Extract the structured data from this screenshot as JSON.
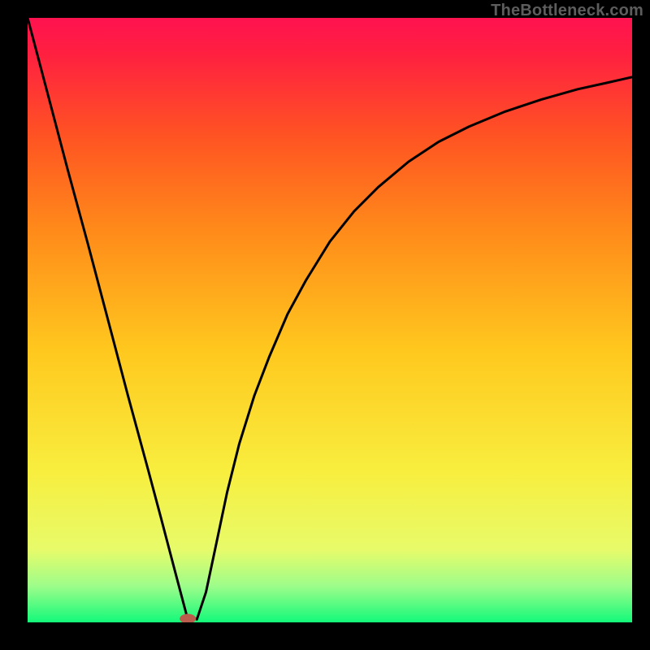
{
  "watermark": {
    "text": "TheBottleneck.com"
  },
  "chart_data": {
    "type": "line",
    "title": "",
    "xlabel": "",
    "ylabel": "",
    "xlim": [
      0,
      1
    ],
    "ylim": [
      0,
      1
    ],
    "grid": false,
    "background_gradient": {
      "stops": [
        {
          "offset": 0.0,
          "color": "#ff1250"
        },
        {
          "offset": 0.06,
          "color": "#ff2040"
        },
        {
          "offset": 0.2,
          "color": "#ff5522"
        },
        {
          "offset": 0.35,
          "color": "#ff8a1a"
        },
        {
          "offset": 0.55,
          "color": "#ffc81e"
        },
        {
          "offset": 0.75,
          "color": "#f8ee3e"
        },
        {
          "offset": 0.88,
          "color": "#e7fb6a"
        },
        {
          "offset": 0.94,
          "color": "#9dfd8a"
        },
        {
          "offset": 1.0,
          "color": "#13f97a"
        }
      ]
    },
    "series": [
      {
        "name": "bottleneck-curve",
        "color": "#000000",
        "width": 3,
        "x": [
          0.0,
          0.033,
          0.066,
          0.1,
          0.133,
          0.166,
          0.2,
          0.22,
          0.245,
          0.263,
          0.28,
          0.295,
          0.31,
          0.33,
          0.35,
          0.375,
          0.4,
          0.43,
          0.46,
          0.5,
          0.54,
          0.58,
          0.63,
          0.68,
          0.73,
          0.79,
          0.85,
          0.91,
          0.96,
          1.0
        ],
        "y": [
          1.0,
          0.875,
          0.75,
          0.625,
          0.5,
          0.375,
          0.25,
          0.175,
          0.08,
          0.012,
          0.005,
          0.05,
          0.12,
          0.215,
          0.295,
          0.375,
          0.44,
          0.51,
          0.565,
          0.63,
          0.68,
          0.72,
          0.762,
          0.795,
          0.82,
          0.845,
          0.865,
          0.882,
          0.893,
          0.902
        ]
      }
    ],
    "marker": {
      "x": 0.265,
      "y": 0.006,
      "rx": 10,
      "ry": 6,
      "color": "#bb5d4d"
    }
  }
}
